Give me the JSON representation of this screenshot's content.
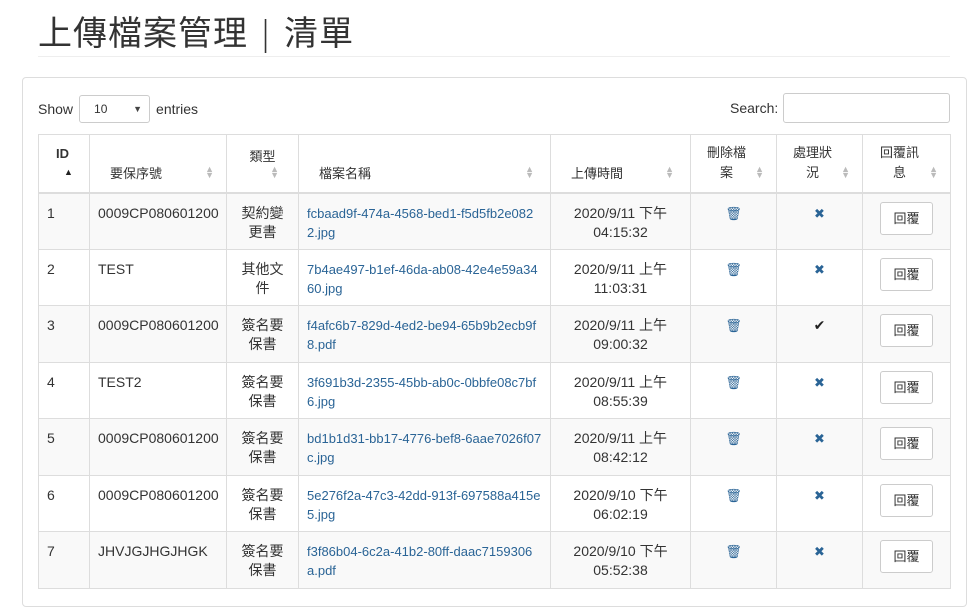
{
  "page": {
    "title": "上傳檔案管理 | 清單"
  },
  "controls": {
    "show_label": "Show",
    "page_length": "10",
    "entries_label": "entries",
    "search_label": "Search:"
  },
  "table": {
    "headers": {
      "id": "ID",
      "policy_no": "要保序號",
      "type": "類型",
      "file_name": "檔案名稱",
      "upload_time": "上傳時間",
      "delete": "刪除檔案",
      "status": "處理狀況",
      "reply": "回覆訊息"
    },
    "reply_label": "回覆",
    "rows": [
      {
        "id": "1",
        "policy_no": "0009CP080601200",
        "type": "契約變更書",
        "file": "fcbaad9f-474a-4568-bed1-f5d5fb2e0822.jpg",
        "time_date": "2020/9/11 下午",
        "time_clock": "04:15:32",
        "status": "x"
      },
      {
        "id": "2",
        "policy_no": "TEST",
        "type": "其他文件",
        "file": "7b4ae497-b1ef-46da-ab08-42e4e59a3460.jpg",
        "time_date": "2020/9/11 上午",
        "time_clock": "11:03:31",
        "status": "x"
      },
      {
        "id": "3",
        "policy_no": "0009CP080601200",
        "type": "簽名要保書",
        "file": "f4afc6b7-829d-4ed2-be94-65b9b2ecb9f8.pdf",
        "time_date": "2020/9/11 上午",
        "time_clock": "09:00:32",
        "status": "check"
      },
      {
        "id": "4",
        "policy_no": "TEST2",
        "type": "簽名要保書",
        "file": "3f691b3d-2355-45bb-ab0c-0bbfe08c7bf6.jpg",
        "time_date": "2020/9/11 上午",
        "time_clock": "08:55:39",
        "status": "x"
      },
      {
        "id": "5",
        "policy_no": "0009CP080601200",
        "type": "簽名要保書",
        "file": "bd1b1d31-bb17-4776-bef8-6aae7026f07c.jpg",
        "time_date": "2020/9/11 上午",
        "time_clock": "08:42:12",
        "status": "x"
      },
      {
        "id": "6",
        "policy_no": "0009CP080601200",
        "type": "簽名要保書",
        "file": "5e276f2a-47c3-42dd-913f-697588a415e5.jpg",
        "time_date": "2020/9/10 下午",
        "time_clock": "06:02:19",
        "status": "x"
      },
      {
        "id": "7",
        "policy_no": "JHVJGJHGJHGK",
        "type": "簽名要保書",
        "file": "f3f86b04-6c2a-41b2-80ff-daac7159306a.pdf",
        "time_date": "2020/9/10 下午",
        "time_clock": "05:52:38",
        "status": "x"
      }
    ]
  },
  "icons": {
    "delete": "trash-icon",
    "status_pending": "x-icon",
    "status_done": "check-icon",
    "sort": "sort-icon",
    "sort_asc": "sort-asc-icon"
  },
  "colors": {
    "link": "#2a6496",
    "border": "#dddddd",
    "stripe": "#f9f9f9"
  }
}
